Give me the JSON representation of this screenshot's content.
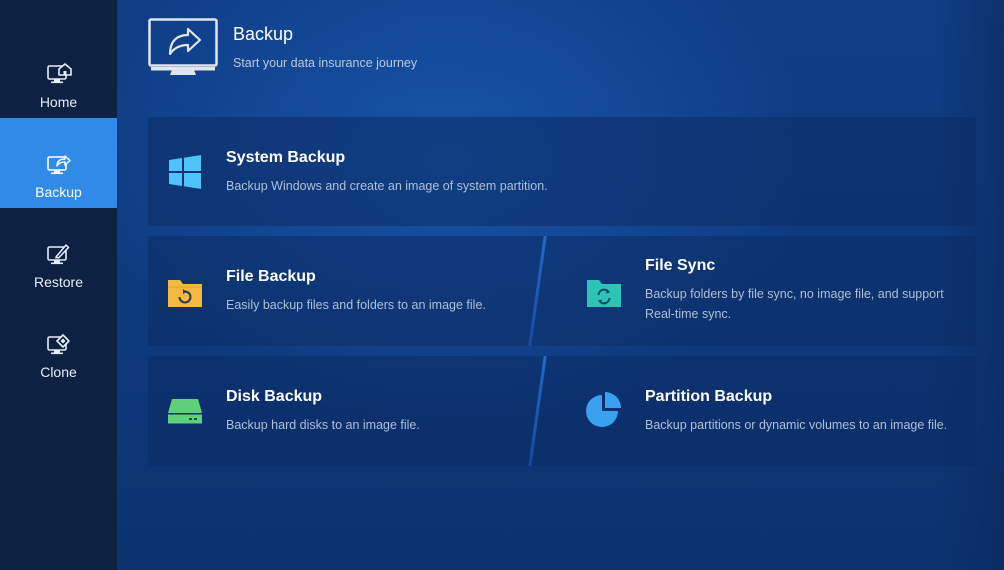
{
  "sidebar": {
    "items": [
      {
        "label": "Home",
        "icon": "home-icon"
      },
      {
        "label": "Backup",
        "icon": "backup-icon",
        "active": true
      },
      {
        "label": "Restore",
        "icon": "restore-icon"
      },
      {
        "label": "Clone",
        "icon": "clone-icon"
      }
    ]
  },
  "header": {
    "title": "Backup",
    "subtitle": "Start your data insurance journey",
    "icon": "monitor-share-icon"
  },
  "cards": {
    "system_backup": {
      "title": "System Backup",
      "desc": "Backup Windows and create an image of system partition.",
      "icon": "windows-icon",
      "color": "#4fc3f7"
    },
    "file_backup": {
      "title": "File Backup",
      "desc": "Easily backup files and folders to an image file.",
      "icon": "folder-refresh-icon",
      "color": "#f5b942"
    },
    "file_sync": {
      "title": "File Sync",
      "desc_line1": "Backup folders by file sync, no image file, and support",
      "desc_line2": "Real-time sync.",
      "icon": "folder-sync-icon",
      "color": "#2cc4b5"
    },
    "disk_backup": {
      "title": "Disk Backup",
      "desc": "Backup hard disks to an image file.",
      "icon": "hard-disk-icon",
      "color": "#5fd07a"
    },
    "partition_backup": {
      "title": "Partition Backup",
      "desc": "Backup partitions or dynamic volumes to an image file.",
      "icon": "pie-chart-icon",
      "color": "#3aa0f0"
    }
  },
  "colors": {
    "sidebar_bg": "#0d2142",
    "active_bg": "#2f8ae8",
    "main_bg": "#0f3e86"
  }
}
